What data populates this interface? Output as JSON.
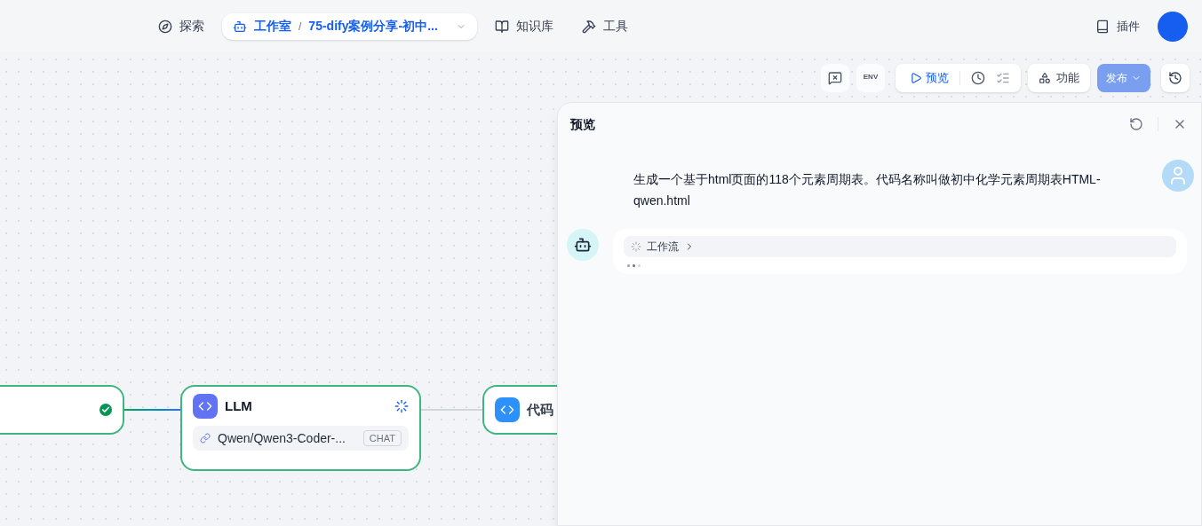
{
  "top_nav": {
    "items": [
      {
        "kind": "link",
        "label": "探索",
        "selected": false
      },
      {
        "kind": "crumb",
        "label": "工作室",
        "separator": "/",
        "app": "75-dify案例分享-初中...",
        "selected": true
      },
      {
        "kind": "link",
        "label": "知识库",
        "selected": false
      },
      {
        "kind": "link",
        "label": "工具",
        "selected": false
      }
    ],
    "plugins": "插件"
  },
  "toolbar": {
    "env": "ENV",
    "preview": "预览",
    "features": "功能",
    "publish": {
      "label": "发布",
      "disabled": true
    }
  },
  "preview_panel": {
    "title": "预览",
    "user_message": "生成一个基于html页面的118个元素周期表。代码名称叫做初中化学元素周期表HTML-qwen.html",
    "workflow": {
      "label": "工作流",
      "running": true
    }
  },
  "nodes": [
    {
      "kind": "start",
      "succeeded": true
    },
    {
      "kind": "llm",
      "title": "LLM",
      "running": true,
      "model": "Qwen/Qwen3-Coder-...",
      "mode": "CHAT"
    },
    {
      "kind": "code",
      "title": "代码"
    }
  ]
}
